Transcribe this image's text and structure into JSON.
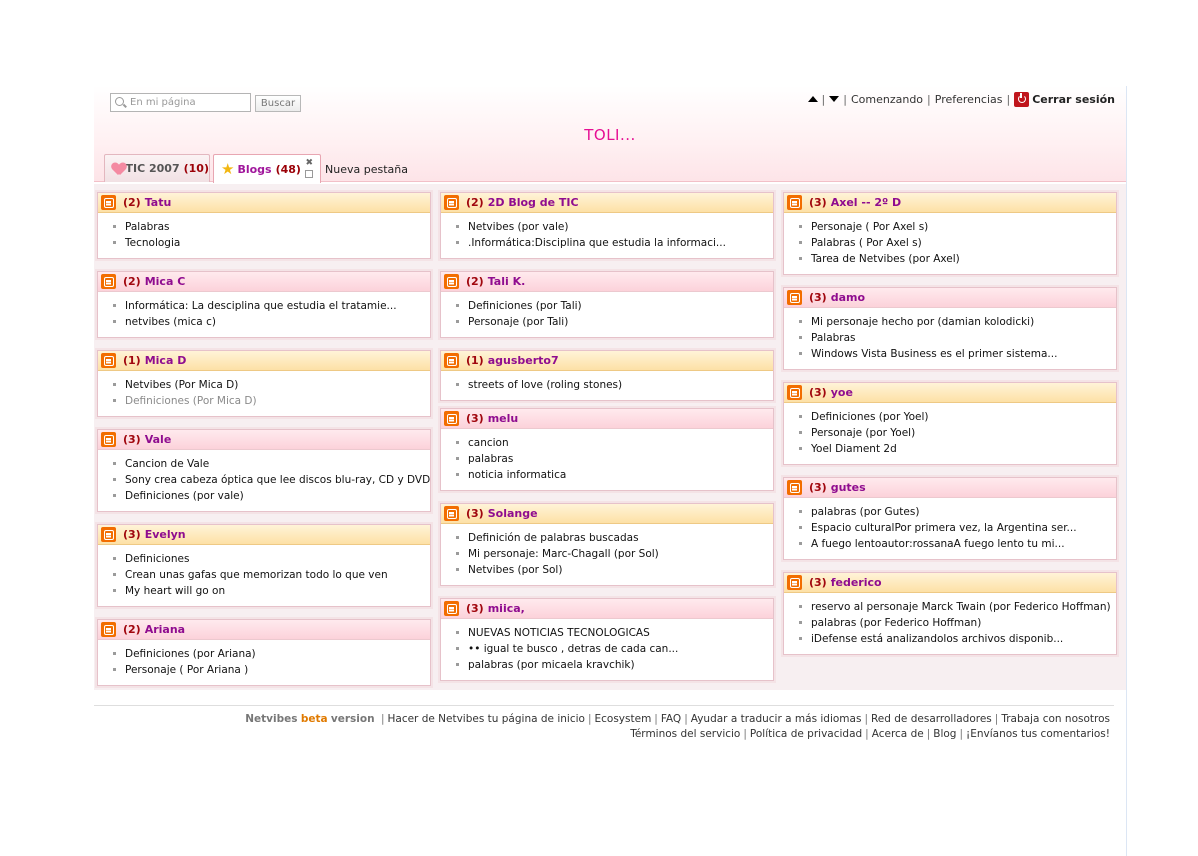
{
  "search": {
    "placeholder": "En mi página",
    "button": "Buscar"
  },
  "topnav": {
    "links": [
      "Comenzando",
      "Preferencias"
    ],
    "logout": "Cerrar sesión"
  },
  "page_title": "TOLI...",
  "tabs": [
    {
      "label": "TIC 2007",
      "count": "(10)",
      "icon": "heart-icon"
    },
    {
      "label": "Blogs",
      "count": "(48)",
      "icon": "star-icon"
    }
  ],
  "new_tab": "Nueva pestaña",
  "columns": [
    [
      {
        "count": "(2)",
        "title": "Tatu",
        "head": "orange",
        "items": [
          "Palabras",
          "Tecnologia"
        ]
      },
      {
        "count": "(2)",
        "title": "Mica C",
        "head": "pink",
        "items": [
          "Informática: La desciplina que estudia el tratamie...",
          "netvibes (mica c)"
        ]
      },
      {
        "count": "(1)",
        "title": "Mica D",
        "head": "orange",
        "items": [
          "Netvibes (Por Mica D)",
          "Definiciones (Por Mica D)"
        ]
      },
      {
        "count": "(3)",
        "title": "Vale",
        "head": "pink",
        "items": [
          "Cancion de Vale",
          "Sony crea cabeza óptica que lee discos blu-ray, CD y DVD",
          "Definiciones (por vale)"
        ]
      },
      {
        "count": "(3)",
        "title": "Evelyn",
        "head": "orange",
        "items": [
          "Definiciones",
          "Crean unas gafas que memorizan todo lo que ven",
          "My heart will go on"
        ]
      },
      {
        "count": "(2)",
        "title": "Ariana",
        "head": "pink",
        "items": [
          "Definiciones (por Ariana)",
          "Personaje ( Por Ariana )"
        ]
      }
    ],
    [
      {
        "count": "(2)",
        "title": "2D Blog de TIC",
        "head": "orange",
        "items": [
          "Netvibes (por vale)",
          ".Informática:Disciplina que estudia la informaci..."
        ]
      },
      {
        "count": "(2)",
        "title": "Tali K.",
        "head": "pink",
        "items": [
          "Definiciones (por Tali)",
          "Personaje (por Tali)"
        ]
      },
      {
        "count": "(1)",
        "title": "agusberto7",
        "head": "orange",
        "items": [
          "streets of love (roling stones)"
        ]
      },
      {
        "count": "(3)",
        "title": "melu",
        "head": "pink",
        "items": [
          "cancion",
          "palabras",
          "noticia informatica"
        ]
      },
      {
        "count": "(3)",
        "title": "Solange",
        "head": "orange",
        "items": [
          "Definición de palabras buscadas",
          "Mi personaje: Marc-Chagall (por Sol)",
          "Netvibes (por Sol)"
        ]
      },
      {
        "count": "(3)",
        "title": "miica,",
        "head": "pink",
        "items": [
          "NUEVAS NOTICIAS TECNOLOGICAS",
          "•• igual te busco , detras de cada can...",
          "palabras (por micaela kravchik)"
        ]
      }
    ],
    [
      {
        "count": "(3)",
        "title": "Axel -- 2º D",
        "head": "orange",
        "items": [
          "Personaje ( Por Axel s)",
          "Palabras ( Por Axel s)",
          "Tarea de Netvibes (por Axel)"
        ]
      },
      {
        "count": "(3)",
        "title": "damo",
        "head": "pink",
        "items": [
          "Mi personaje hecho por (damian kolodicki)",
          "Palabras",
          "Windows Vista Business es el primer sistema..."
        ]
      },
      {
        "count": "(3)",
        "title": "yoe",
        "head": "orange",
        "items": [
          "Definiciones (por Yoel)",
          "Personaje (por Yoel)",
          "Yoel Diament 2d"
        ]
      },
      {
        "count": "(3)",
        "title": "gutes",
        "head": "pink",
        "items": [
          "palabras (por Gutes)",
          "Espacio culturalPor primera vez, la Argentina ser...",
          "A fuego lentoautor:rossanaA fuego lento tu mi..."
        ]
      },
      {
        "count": "(3)",
        "title": "federico",
        "head": "orange",
        "items": [
          "reservo al personaje Marck Twain (por Federico Hoffman)",
          "palabras (por Federico Hoffman)",
          "iDefense está analizandolos archivos disponib..."
        ]
      }
    ]
  ],
  "visited_items": [
    "Definiciones (Por Mica D)"
  ],
  "footer": {
    "brand": "Netvibes",
    "beta": "beta",
    "version": "version",
    "line1": [
      "Hacer de Netvibes tu página de inicio",
      "Ecosystem",
      "FAQ",
      "Ayudar a traducir a más idiomas",
      "Red de desarrolladores",
      "Trabaja con nosotros"
    ],
    "line2": [
      "Términos del servicio",
      "Política de privacidad",
      "Acerca de",
      "Blog",
      "¡Envíanos tus comentarios!"
    ]
  },
  "colors": {
    "title": "#e60f94",
    "widget_title": "#8f0c8f",
    "count": "#a0070e",
    "blogger": "#f26d00",
    "beta": "#e07a00"
  }
}
